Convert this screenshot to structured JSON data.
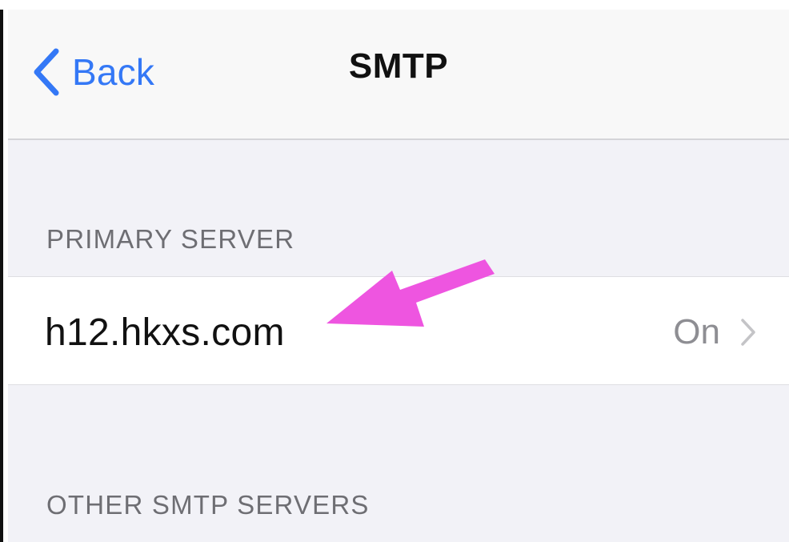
{
  "nav": {
    "back_label": "Back",
    "title": "SMTP"
  },
  "sections": {
    "primary_header": "PRIMARY SERVER",
    "other_header": "OTHER SMTP SERVERS"
  },
  "primary_server": {
    "host": "h12.hkxs.com",
    "status": "On"
  },
  "colors": {
    "accent": "#3478f6",
    "annotation_arrow": "#ee55e0",
    "secondary_text": "#8e8e93",
    "background": "#f2f2f7"
  },
  "icons": {
    "back": "chevron-left-icon",
    "disclosure": "chevron-right-icon",
    "annotation": "arrow-annotation-icon"
  }
}
